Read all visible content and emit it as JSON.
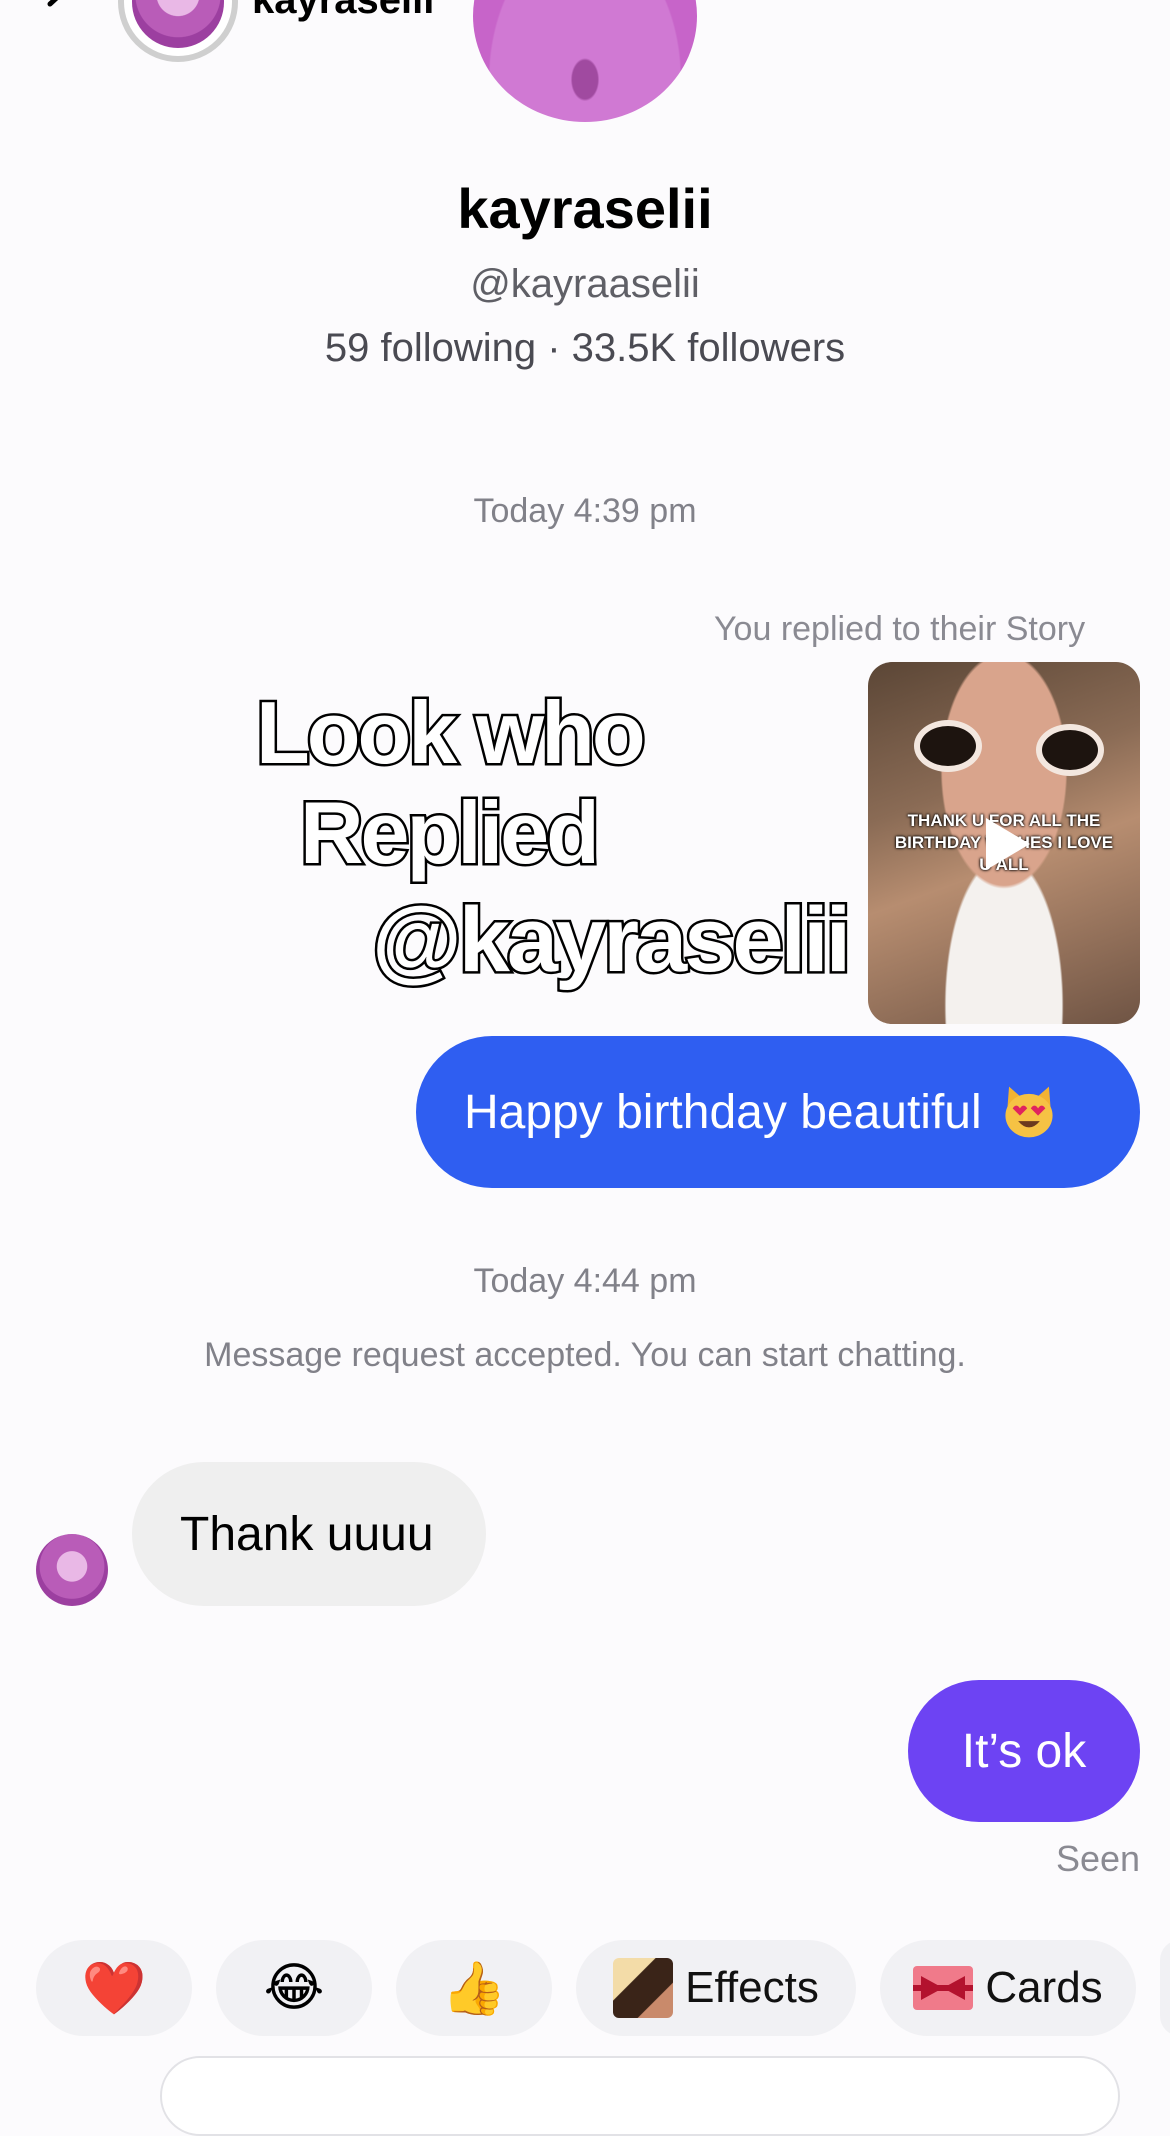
{
  "header": {
    "username": "kayraselii"
  },
  "profile": {
    "name": "kayraselii",
    "handle": "@kayraaselii",
    "stats": "59 following · 33.5K followers"
  },
  "thread": {
    "timestamp_1": "Today 4:39 pm",
    "story_note": "You replied to their Story",
    "overlay_line1": "Look who",
    "overlay_line2": "Replied",
    "overlay_line3": "@kayraselii",
    "story_caption": "THANK U FOR ALL THE BIRTHDAY WISHES I LOVE U ALL",
    "message_1": "Happy birthday beautiful",
    "timestamp_2": "Today 4:44 pm",
    "system_note": "Message request accepted. You can start chatting.",
    "message_2": "Thank uuuu",
    "message_3": "It’s ok",
    "seen": "Seen"
  },
  "quick_bar": {
    "heart_emoji": "❤️",
    "laugh_emoji": "😂",
    "thumbs_emoji": "👍",
    "effects_label": "Effects",
    "cards_label": "Cards"
  },
  "colors": {
    "sent_blue": "#2f5ef1",
    "sent_purple": "#6d43f3",
    "received_gray": "#efefef"
  }
}
